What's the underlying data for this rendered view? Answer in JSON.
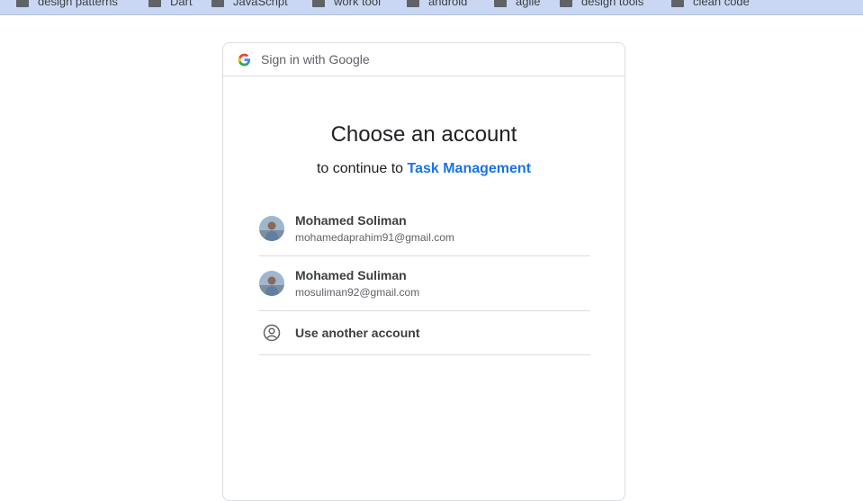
{
  "bookmarks": [
    {
      "label": "design patterns",
      "icon": "folder-icon"
    },
    {
      "label": "Dart",
      "icon": "folder-icon"
    },
    {
      "label": "JavaScript",
      "icon": "folder-icon"
    },
    {
      "label": "work tool",
      "icon": "folder-icon"
    },
    {
      "label": "android",
      "icon": "folder-icon"
    },
    {
      "label": "agile",
      "icon": "folder-icon"
    },
    {
      "label": "design tools",
      "icon": "folder-icon"
    },
    {
      "label": "clean code",
      "icon": "folder-icon"
    }
  ],
  "card": {
    "header_label": "Sign in with Google",
    "title": "Choose an account",
    "subtitle_prefix": "to continue to",
    "app_name": "Task Management"
  },
  "accounts": [
    {
      "name": "Mohamed Soliman",
      "email": "mohamedaprahim91@gmail.com"
    },
    {
      "name": "Mohamed Suliman",
      "email": "mosuliman92@gmail.com"
    }
  ],
  "other_account": {
    "label": "Use another account",
    "icon": "person-circle-icon"
  },
  "colors": {
    "bookmarks_bar": "#c9d7f3",
    "link": "#1a73e8",
    "divider": "#dadce0"
  }
}
